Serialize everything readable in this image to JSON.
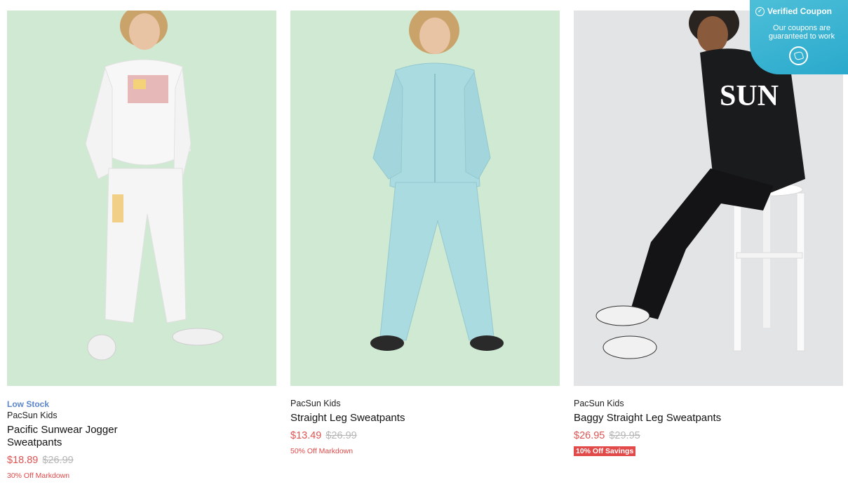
{
  "products": [
    {
      "stock_label": "Low Stock",
      "brand": "PacSun Kids",
      "name": "Pacific Sunwear Jogger Sweatpants",
      "sale_price": "$18.89",
      "original_price": "$26.99",
      "promo": "30% Off Markdown",
      "image": "boy-white-sweatsuit-photo"
    },
    {
      "brand": "PacSun Kids",
      "name": "Straight Leg Sweatpants",
      "sale_price": "$13.49",
      "original_price": "$26.99",
      "promo": "50% Off Markdown",
      "image": "boy-blue-sweatsuit-photo"
    },
    {
      "brand": "PacSun Kids",
      "name": "Baggy Straight Leg Sweatpants",
      "sale_price": "$26.95",
      "original_price": "$29.95",
      "promo": "10% Off Savings",
      "image": "boy-black-sweatsuit-photo"
    }
  ],
  "coupon_widget": {
    "title": "Verified Coupon",
    "text": "Our coupons are guaranteed to work",
    "icon": "coupon-logo-icon"
  },
  "colors": {
    "sale": "#e05353",
    "strike": "#b5b5b5",
    "low_stock": "#5b86c9",
    "coupon_bg": "#2aa9cc"
  }
}
